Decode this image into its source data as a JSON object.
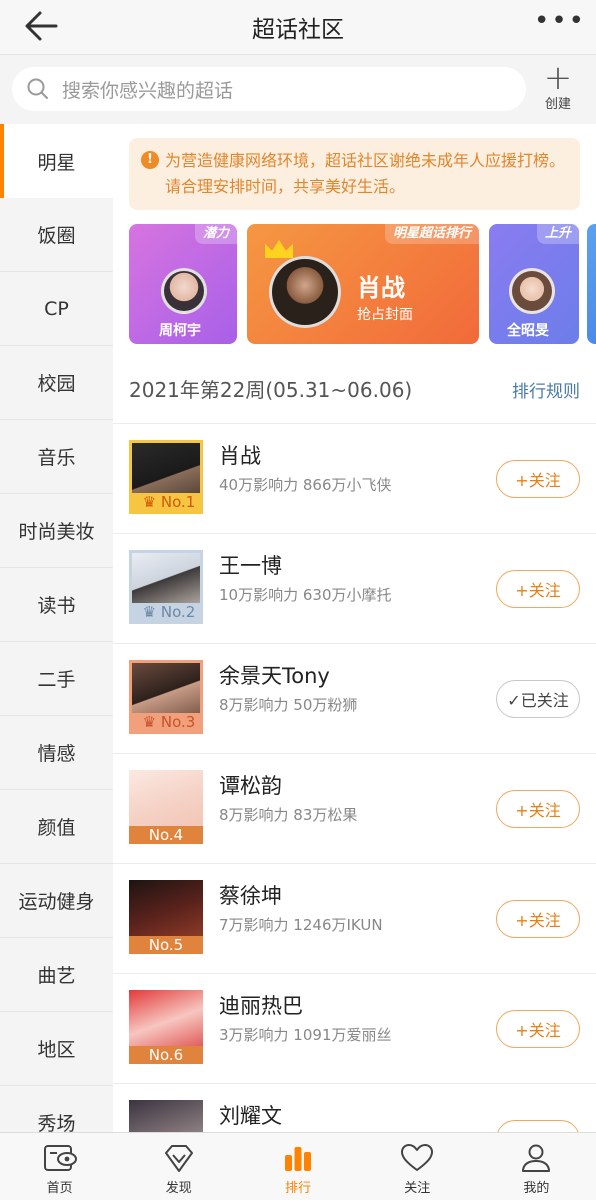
{
  "header": {
    "title": "超话社区"
  },
  "search": {
    "placeholder": "搜索你感兴趣的超话",
    "create_label": "创建"
  },
  "sidebar": {
    "items": [
      {
        "label": "明星",
        "active": true
      },
      {
        "label": "饭圈"
      },
      {
        "label": "CP"
      },
      {
        "label": "校园"
      },
      {
        "label": "音乐"
      },
      {
        "label": "时尚美妆"
      },
      {
        "label": "读书"
      },
      {
        "label": "二手"
      },
      {
        "label": "情感"
      },
      {
        "label": "颜值"
      },
      {
        "label": "运动健身"
      },
      {
        "label": "曲艺"
      },
      {
        "label": "地区"
      },
      {
        "label": "秀场"
      }
    ]
  },
  "notice": {
    "text": "为营造健康网络环境，超话社区谢绝未成年人应援打榜。请合理安排时间，共享美好生活。"
  },
  "cards": [
    {
      "tag": "潜力",
      "name": "周柯宇"
    },
    {
      "tag": "明星超话排行",
      "name": "肖战",
      "sub": "抢占封面"
    },
    {
      "tag": "上升",
      "name": "全昭旻"
    }
  ],
  "week": {
    "label": "2021年第22周(05.31~06.06)",
    "rule_label": "排行规则"
  },
  "ranking": [
    {
      "rank": "No.1",
      "name": "肖战",
      "meta": "40万影响力  866万小飞侠",
      "button": "+关注",
      "followed": false
    },
    {
      "rank": "No.2",
      "name": "王一博",
      "meta": "10万影响力  630万小摩托",
      "button": "+关注",
      "followed": false
    },
    {
      "rank": "No.3",
      "name": "余景天Tony",
      "meta": "8万影响力  50万粉狮",
      "button": "✓已关注",
      "followed": true
    },
    {
      "rank": "No.4",
      "name": "谭松韵",
      "meta": "8万影响力  83万松果",
      "button": "+关注",
      "followed": false
    },
    {
      "rank": "No.5",
      "name": "蔡徐坤",
      "meta": "7万影响力  1246万IKUN",
      "button": "+关注",
      "followed": false
    },
    {
      "rank": "No.6",
      "name": "迪丽热巴",
      "meta": "3万影响力  1091万爱丽丝",
      "button": "+关注",
      "followed": false
    },
    {
      "rank": "",
      "name": "刘耀文",
      "meta": "",
      "button": "",
      "followed": false
    }
  ],
  "nav": [
    {
      "label": "首页",
      "icon": "home-icon"
    },
    {
      "label": "发现",
      "icon": "discover-icon"
    },
    {
      "label": "排行",
      "icon": "ranking-icon",
      "active": true
    },
    {
      "label": "关注",
      "icon": "heart-icon"
    },
    {
      "label": "我的",
      "icon": "profile-icon"
    }
  ],
  "colors": {
    "accent": "#ff8200",
    "gold": "#f6c643",
    "silver": "#c5d3e3",
    "bronze": "#f2a07b"
  }
}
